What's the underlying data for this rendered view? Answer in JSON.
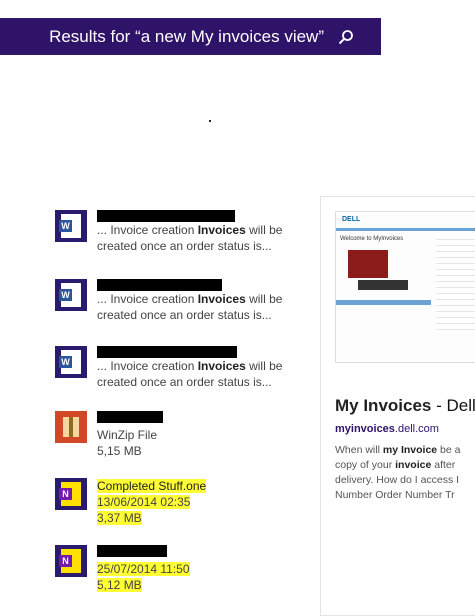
{
  "search": {
    "query_label": "Results for “a new My invoices view”"
  },
  "results": [
    {
      "line1": "... Invoice creation ",
      "bold": "Invoices",
      "line1b": " will be",
      "line2": "created once an order status is..."
    },
    {
      "line1": "... Invoice creation ",
      "bold": "Invoices",
      "line1b": " will be",
      "line2": "created once an order status is..."
    },
    {
      "line1": "... Invoice creation ",
      "bold": "Invoices",
      "line1b": " will be",
      "line2": "created once an order status is..."
    }
  ],
  "files": [
    {
      "type": "WinZip File",
      "size": "5,15 MB"
    },
    {
      "name": "Completed Stuff.one",
      "date": "13/06/2014 02:35",
      "size": "3,37 MB"
    },
    {
      "date": "25/07/2014 11:50",
      "size": "5,12 MB"
    }
  ],
  "preview": {
    "title_bold": "My Invoices",
    "title_rest": " - Dell",
    "url_bold": "myinvoices",
    "url_rest": ".dell.com",
    "snippet_1": "When will ",
    "snippet_b1": "my Invoice",
    "snippet_2": " be a",
    "snippet_3": "copy of your ",
    "snippet_b2": "invoice",
    "snippet_4": " after",
    "snippet_5": "delivery. How do I access I",
    "snippet_6": "Number Order Number Tr",
    "thumb_brand": "DELL",
    "thumb_heading": "Welcome to MyInvoices"
  },
  "colors": {
    "accent": "#2e1368",
    "highlight": "#ffff33",
    "word": "#2b579a",
    "onenote": "#7719aa"
  }
}
